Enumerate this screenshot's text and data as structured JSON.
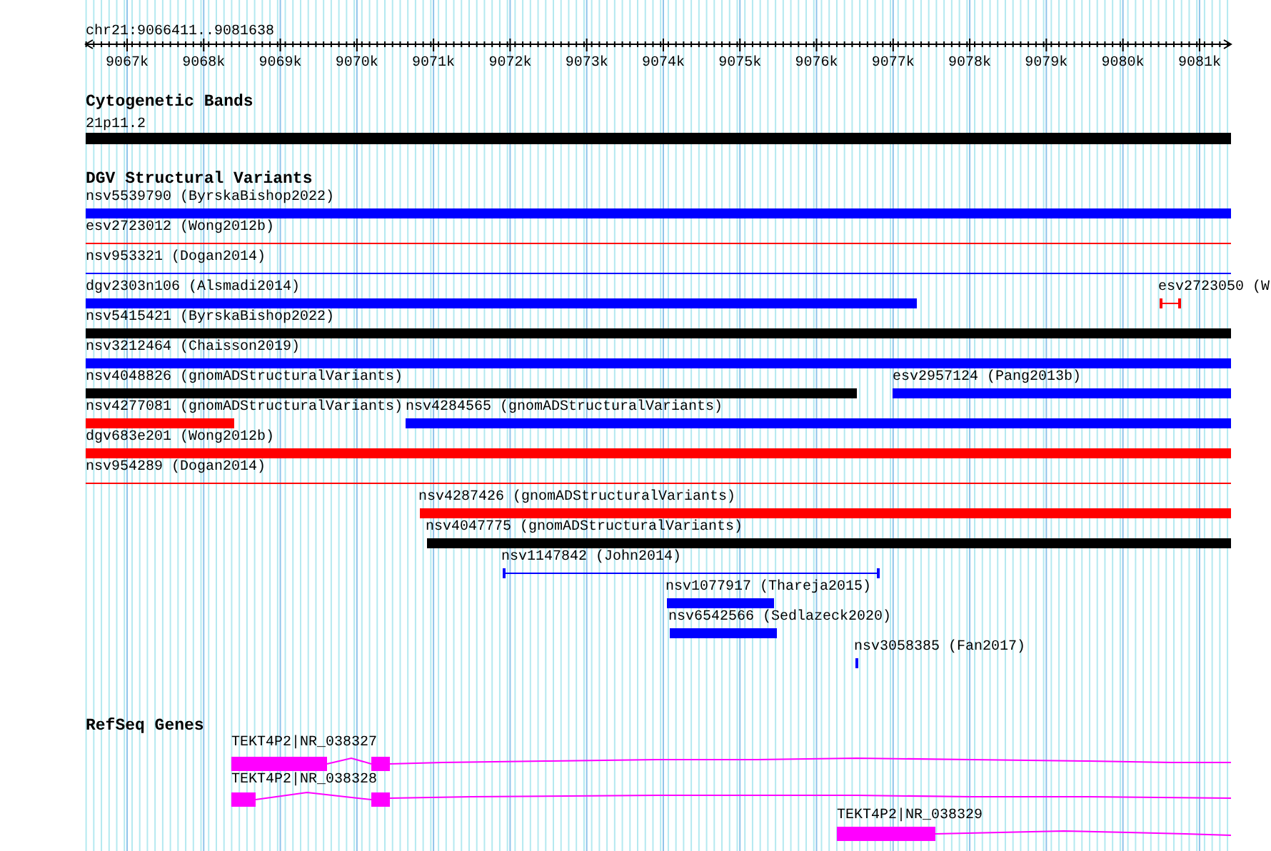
{
  "locus": "chr21:9066411..9081638",
  "ruler": {
    "ticks": [
      "9067k",
      "9068k",
      "9069k",
      "9070k",
      "9071k",
      "9072k",
      "9073k",
      "9074k",
      "9075k",
      "9076k",
      "9077k",
      "9078k",
      "9079k",
      "9080k",
      "9081k"
    ]
  },
  "tracks": [
    {
      "title": "Cytogenetic Bands",
      "kind": "cytoband",
      "bands": [
        {
          "label": "21p11.2"
        }
      ]
    },
    {
      "title": "DGV Structural Variants",
      "kind": "variants",
      "features": [
        {
          "label": "nsv5539790 (ByrskaBishop2022)",
          "kind": "bar",
          "color": "#0000ff"
        },
        {
          "label": "esv2723012 (Wong2012b)",
          "kind": "line",
          "color": "#ff0000"
        },
        {
          "label": "nsv953321 (Dogan2014)",
          "kind": "line",
          "color": "#0000ff"
        },
        {
          "label": "dgv2303n106 (Alsmadi2014)",
          "kind": "bar",
          "color": "#0000ff"
        },
        {
          "label": "esv2723050 (W",
          "kind": "interval",
          "color": "#ff0000"
        },
        {
          "label": "nsv5415421 (ByrskaBishop2022)",
          "kind": "bar",
          "color": "#000000"
        },
        {
          "label": "nsv3212464 (Chaisson2019)",
          "kind": "bar",
          "color": "#0000ff"
        },
        {
          "label": "nsv4048826 (gnomADStructuralVariants)",
          "kind": "bar",
          "color": "#000000"
        },
        {
          "label": "esv2957124 (Pang2013b)",
          "kind": "bar",
          "color": "#0000ff"
        },
        {
          "label": "nsv4277081 (gnomADStructuralVariants)",
          "kind": "bar",
          "color": "#ff0000"
        },
        {
          "label": "nsv4284565 (gnomADStructuralVariants)",
          "kind": "bar",
          "color": "#0000ff"
        },
        {
          "label": "dgv683e201 (Wong2012b)",
          "kind": "bar",
          "color": "#ff0000"
        },
        {
          "label": "nsv954289 (Dogan2014)",
          "kind": "line",
          "color": "#ff0000"
        },
        {
          "label": "nsv4287426 (gnomADStructuralVariants)",
          "kind": "bar",
          "color": "#ff0000"
        },
        {
          "label": "nsv4047775 (gnomADStructuralVariants)",
          "kind": "bar",
          "color": "#000000"
        },
        {
          "label": "nsv1147842 (John2014)",
          "kind": "interval",
          "color": "#0000ff"
        },
        {
          "label": "nsv1077917 (Thareja2015)",
          "kind": "bar",
          "color": "#0000ff"
        },
        {
          "label": "nsv6542566 (Sedlazeck2020)",
          "kind": "bar",
          "color": "#0000ff"
        },
        {
          "label": "nsv3058385 (Fan2017)",
          "kind": "bar",
          "color": "#0000ff"
        }
      ]
    },
    {
      "title": "RefSeq Genes",
      "kind": "genes",
      "genes": [
        {
          "label": "TEKT4P2|NR_038327"
        },
        {
          "label": "TEKT4P2|NR_038328"
        },
        {
          "label": "TEKT4P2|NR_038329"
        }
      ]
    }
  ]
}
